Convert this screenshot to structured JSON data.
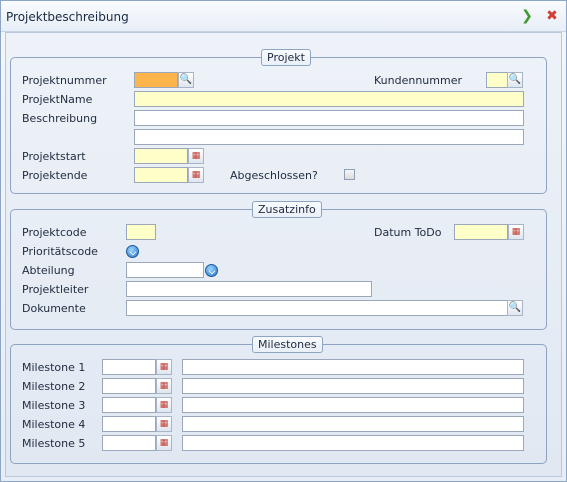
{
  "window": {
    "title": "Projektbeschreibung",
    "ok_icon": "arrow-right-icon",
    "close_icon": "close-icon"
  },
  "projekt": {
    "legend": "Projekt",
    "projektnummer_label": "Projektnummer",
    "kundennummer_label": "Kundennummer",
    "projektname_label": "ProjektName",
    "beschreibung_label": "Beschreibung",
    "projektstart_label": "Projektstart",
    "projektende_label": "Projektende",
    "abgeschlossen_label": "Abgeschlossen?"
  },
  "zusatzinfo": {
    "legend": "Zusatzinfo",
    "projektcode_label": "Projektcode",
    "datum_todo_label": "Datum ToDo",
    "prioritaetscode_label": "Prioritätscode",
    "abteilung_label": "Abteilung",
    "projektleiter_label": "Projektleiter",
    "dokumente_label": "Dokumente"
  },
  "milestones": {
    "legend": "Milestones",
    "items": [
      {
        "label": "Milestone 1"
      },
      {
        "label": "Milestone 2"
      },
      {
        "label": "Milestone 3"
      },
      {
        "label": "Milestone 4"
      },
      {
        "label": "Milestone 5"
      }
    ]
  },
  "colors": {
    "required_field": "#fefec9",
    "active_field": "#fdb44d",
    "border": "#8da4c3"
  }
}
